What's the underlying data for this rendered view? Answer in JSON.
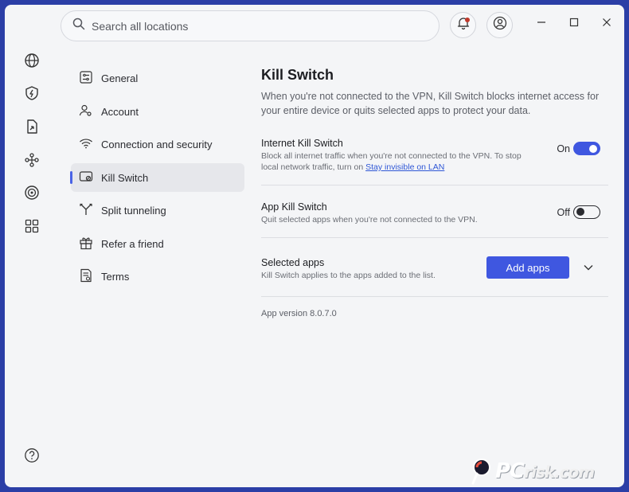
{
  "search": {
    "placeholder": "Search all locations"
  },
  "rail": [
    "globe-icon",
    "shield-bolt-icon",
    "file-share-icon",
    "mesh-icon",
    "target-icon",
    "apps-grid-icon"
  ],
  "nav": {
    "items": [
      {
        "label": "General",
        "icon": "sliders-icon"
      },
      {
        "label": "Account",
        "icon": "user-gear-icon"
      },
      {
        "label": "Connection and security",
        "icon": "wifi-icon"
      },
      {
        "label": "Kill Switch",
        "icon": "kill-switch-icon"
      },
      {
        "label": "Split tunneling",
        "icon": "split-icon"
      },
      {
        "label": "Refer a friend",
        "icon": "gift-icon"
      },
      {
        "label": "Terms",
        "icon": "document-icon"
      }
    ],
    "active_index": 3
  },
  "main": {
    "title": "Kill Switch",
    "description": "When you're not connected to the VPN, Kill Switch blocks internet access for your entire device or quits selected apps to protect your data.",
    "internet": {
      "title": "Internet Kill Switch",
      "sub_pre": "Block all internet traffic when you're not connected to the VPN. To stop local network traffic, turn on ",
      "sub_link": "Stay invisible on LAN",
      "state_label": "On",
      "enabled": true
    },
    "app": {
      "title": "App Kill Switch",
      "sub": "Quit selected apps when you're not connected to the VPN.",
      "state_label": "Off",
      "enabled": false
    },
    "selected": {
      "title": "Selected apps",
      "sub": "Kill Switch applies to the apps added to the list.",
      "button": "Add apps"
    },
    "version": "App version 8.0.7.0"
  },
  "colors": {
    "accent": "#3f57e0",
    "background": "#f4f5f7",
    "active_nav": "#e6e7eb"
  },
  "watermark": {
    "text": "PC",
    "text2": "risk.com"
  }
}
